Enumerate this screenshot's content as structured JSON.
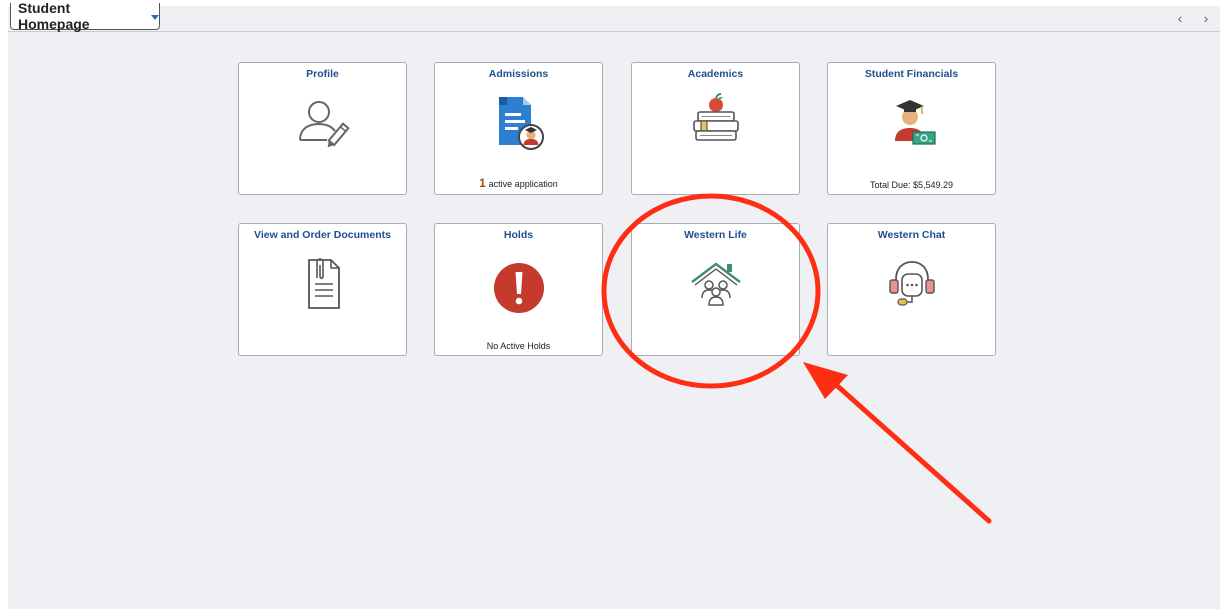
{
  "header": {
    "homepage_label": "Student Homepage",
    "prev_label": "‹",
    "next_label": "›"
  },
  "tiles": [
    {
      "title": "Profile",
      "icon": "profile-edit-icon"
    },
    {
      "title": "Admissions",
      "icon": "application-document-icon",
      "count": "1",
      "footer": "active application"
    },
    {
      "title": "Academics",
      "icon": "books-apple-icon"
    },
    {
      "title": "Student Financials",
      "icon": "graduate-money-icon",
      "footer": "Total Due:  $5,549.29"
    },
    {
      "title": "View and Order Documents",
      "icon": "document-paperclip-icon"
    },
    {
      "title": "Holds",
      "icon": "exclamation-alert-icon",
      "footer": "No Active Holds"
    },
    {
      "title": "Western Life",
      "icon": "house-people-icon"
    },
    {
      "title": "Western Chat",
      "icon": "headset-chat-icon"
    }
  ],
  "colors": {
    "background": "#eff0f4",
    "tile_title": "#1e4f8c",
    "annotation": "#ff2d14",
    "hold_red": "#c43a2e"
  }
}
